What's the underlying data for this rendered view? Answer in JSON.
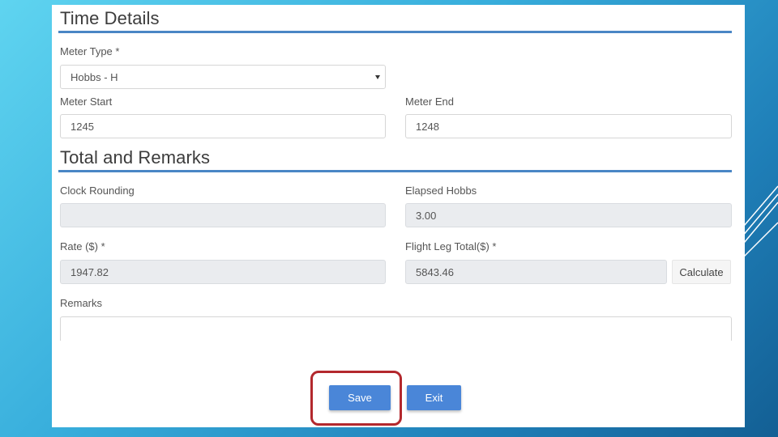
{
  "time_details": {
    "title": "Time Details",
    "meter_type_label": "Meter Type *",
    "meter_type_value": "Hobbs - H",
    "meter_start_label": "Meter Start",
    "meter_start_value": "1245",
    "meter_end_label": "Meter End",
    "meter_end_value": "1248"
  },
  "total_remarks": {
    "title": "Total and Remarks",
    "clock_rounding_label": "Clock Rounding",
    "clock_rounding_value": "",
    "elapsed_hobbs_label": "Elapsed Hobbs",
    "elapsed_hobbs_value": "3.00",
    "rate_label": "Rate ($) *",
    "rate_value": "1947.82",
    "flight_leg_total_label": "Flight Leg Total($) *",
    "flight_leg_total_value": "5843.46",
    "calculate_label": "Calculate",
    "remarks_label": "Remarks",
    "remarks_value": ""
  },
  "actions": {
    "save_label": "Save",
    "exit_label": "Exit"
  },
  "colors": {
    "accent_rule": "#4a86c5",
    "button_primary": "#4a86d8",
    "highlight_border": "#b3282d"
  }
}
